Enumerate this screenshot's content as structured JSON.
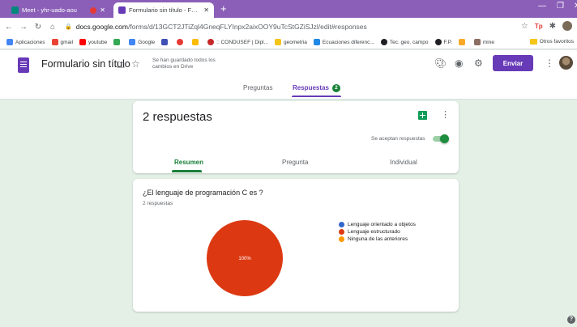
{
  "browser": {
    "tabs": [
      {
        "title": "Meet - yhr-uado-aou",
        "favicon_color": "#00897b"
      },
      {
        "title": "Formulario sin título - Formulario",
        "favicon_color": "#673ab7"
      }
    ],
    "new_tab": "+",
    "url_host": "docs.google.com",
    "url_path": "/forms/d/13GCT2JTiZql4GneqFLYInpx2aixOOY9uTcStGZiSJzl/edit#responses",
    "bookmarks": [
      {
        "label": "Aplicaciones",
        "color": "#4285f4"
      },
      {
        "label": "gmail",
        "color": "#ea4335"
      },
      {
        "label": "youtube",
        "color": "#ff0000"
      },
      {
        "label": "",
        "color": "#34a853"
      },
      {
        "label": "Google",
        "color": "#4285f4"
      },
      {
        "label": "",
        "color": "#3f51b5"
      },
      {
        "label": "",
        "color": "#e53935"
      },
      {
        "label": "",
        "color": "#fbbc05"
      },
      {
        "label": ":: CONDUSEF | Dipl...",
        "color": "#c62828"
      },
      {
        "label": "geometria",
        "color": "#f5c518"
      },
      {
        "label": "Ecuaciones diferenc...",
        "color": "#1e88e5"
      },
      {
        "label": "Tec. geo. campo",
        "color": "#202124"
      },
      {
        "label": "F.P.",
        "color": "#202124"
      },
      {
        "label": "",
        "color": "#f9a825"
      },
      {
        "label": "mine",
        "color": "#8d6e63"
      }
    ],
    "other_bookmarks": "Otros favoritos"
  },
  "header": {
    "title": "Formulario sin título",
    "save_note": "Se han guardado todos los cambios en Drive",
    "send_label": "Enviar"
  },
  "form_tabs": {
    "questions": "Preguntas",
    "responses": "Respuestas",
    "responses_count": "2"
  },
  "summary_card": {
    "title": "2 respuestas",
    "accepting_label": "Se aceptan respuestas",
    "accepting": true,
    "subtabs": [
      "Resumen",
      "Pregunta",
      "Individual"
    ]
  },
  "question_card": {
    "question": "¿El lenguaje de programación C es ?",
    "count": "2 respuestas",
    "pie_label": "100%"
  },
  "chart_data": {
    "type": "pie",
    "categories": [
      "Lenguaje orientado a objetos",
      "Lenguaje estructurado",
      "Ninguna de las anteriores"
    ],
    "values": [
      0,
      100,
      0
    ],
    "colors": [
      "#3366cc",
      "#dc3912",
      "#ff9900"
    ],
    "legend": "right"
  }
}
